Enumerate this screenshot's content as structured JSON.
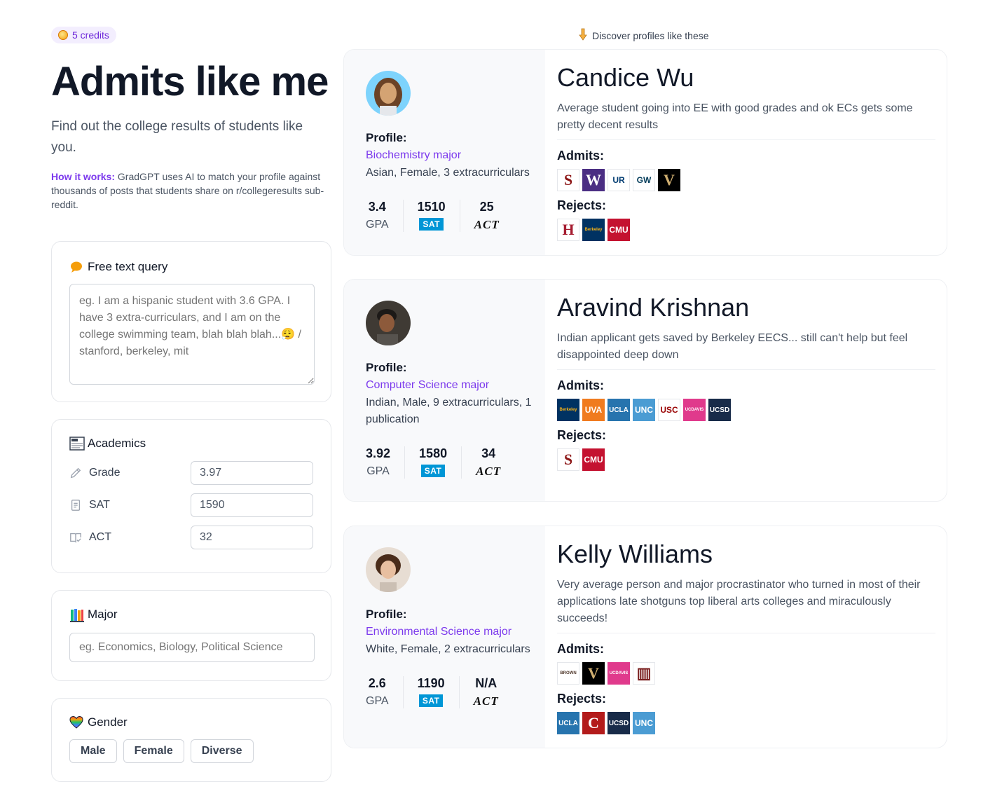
{
  "credits": "5 credits",
  "title": "Admits like me",
  "subtitle": "Find out the college results of students like you.",
  "how_it_works": {
    "label": "How it works:",
    "text": " GradGPT uses AI to match your profile against thousands of posts that students share on r/collegeresults sub-reddit."
  },
  "free_text": {
    "title": "Free text query",
    "placeholder": "eg. I am a hispanic student with 3.6 GPA. I have 3 extra-curriculars, and I am on the college swimming team, blah blah blah...😮‍💨 / stanford, berkeley, mit"
  },
  "academics": {
    "title": "Academics",
    "grade_label": "Grade",
    "grade_value": "3.97",
    "sat_label": "SAT",
    "sat_value": "1590",
    "act_label": "ACT",
    "act_value": "32"
  },
  "major": {
    "title": "Major",
    "placeholder": "eg. Economics, Biology, Political Science"
  },
  "gender": {
    "title": "Gender",
    "options": [
      "Male",
      "Female",
      "Diverse"
    ]
  },
  "discover": "Discover profiles like these",
  "profile_label": "Profile:",
  "gpa_label": "GPA",
  "sat_badge": "SAT",
  "act_badge": "ACT",
  "admits_label": "Admits:",
  "rejects_label": "Rejects:",
  "profiles": [
    {
      "name": "Candice Wu",
      "summary": "Average student going into EE with good grades and ok ECs gets some pretty decent results",
      "major": "Biochemistry major",
      "desc": "Asian, Female, 3 extracurriculars",
      "gpa": "3.4",
      "sat": "1510",
      "act": "25",
      "admits": [
        {
          "name": "stanford-logo",
          "bg": "#ffffff",
          "fg": "#8c1515",
          "text": "S"
        },
        {
          "name": "washington-logo",
          "bg": "#4b2e83",
          "fg": "#ffffff",
          "text": "W"
        },
        {
          "name": "rochester-logo",
          "bg": "#ffffff",
          "fg": "#003b71",
          "text": "UR"
        },
        {
          "name": "gw-logo",
          "bg": "#ffffff",
          "fg": "#033c5a",
          "text": "GW"
        },
        {
          "name": "vanderbilt-logo",
          "bg": "#000000",
          "fg": "#cfae70",
          "text": "V"
        }
      ],
      "rejects": [
        {
          "name": "harvard-logo",
          "bg": "#ffffff",
          "fg": "#a51c30",
          "text": "H"
        },
        {
          "name": "berkeley-logo",
          "bg": "#003262",
          "fg": "#fdb515",
          "text": "Berkeley"
        },
        {
          "name": "cmu-logo",
          "bg": "#c41230",
          "fg": "#ffffff",
          "text": "CMU"
        }
      ]
    },
    {
      "name": "Aravind Krishnan",
      "summary": "Indian applicant gets saved by Berkeley EECS... still can't help but feel disappointed deep down",
      "major": "Computer Science major",
      "desc": "Indian, Male, 9 extracurriculars, 1 publication",
      "gpa": "3.92",
      "sat": "1580",
      "act": "34",
      "admits": [
        {
          "name": "berkeley-logo",
          "bg": "#003262",
          "fg": "#fdb515",
          "text": "Berkeley"
        },
        {
          "name": "uva-logo",
          "bg": "#f07b1f",
          "fg": "#ffffff",
          "text": "UVA"
        },
        {
          "name": "ucla-logo",
          "bg": "#2774ae",
          "fg": "#ffffff",
          "text": "UCLA"
        },
        {
          "name": "unc-logo",
          "bg": "#4b9cd3",
          "fg": "#ffffff",
          "text": "UNC"
        },
        {
          "name": "usc-logo",
          "bg": "#ffffff",
          "fg": "#990000",
          "text": "USC"
        },
        {
          "name": "ucdavis-logo",
          "bg": "#e03a8c",
          "fg": "#ffffff",
          "text": "UCDAVIS"
        },
        {
          "name": "ucsd-logo",
          "bg": "#182b49",
          "fg": "#ffffff",
          "text": "UCSD"
        }
      ],
      "rejects": [
        {
          "name": "stanford-logo",
          "bg": "#ffffff",
          "fg": "#8c1515",
          "text": "S"
        },
        {
          "name": "cmu-logo",
          "bg": "#c41230",
          "fg": "#ffffff",
          "text": "CMU"
        }
      ]
    },
    {
      "name": "Kelly Williams",
      "summary": "Very average person and major procrastinator who turned in most of their applications late shotguns top liberal arts colleges and miraculously succeeds!",
      "major": "Environmental Science major",
      "desc": "White, Female, 2 extracurriculars",
      "gpa": "2.6",
      "sat": "1190",
      "act": "N/A",
      "admits": [
        {
          "name": "brown-logo",
          "bg": "#ffffff",
          "fg": "#4e3629",
          "text": "BROWN"
        },
        {
          "name": "vanderbilt-logo",
          "bg": "#000000",
          "fg": "#cfae70",
          "text": "V"
        },
        {
          "name": "ucdavis-logo",
          "bg": "#e03a8c",
          "fg": "#ffffff",
          "text": "UCDAVIS"
        },
        {
          "name": "college-building-logo",
          "bg": "#ffffff",
          "fg": "#7a1f1f",
          "text": "▥"
        }
      ],
      "rejects": [
        {
          "name": "ucla-logo",
          "bg": "#2774ae",
          "fg": "#ffffff",
          "text": "UCLA"
        },
        {
          "name": "cornell-logo",
          "bg": "#b31b1b",
          "fg": "#ffffff",
          "text": "C"
        },
        {
          "name": "ucsd-logo",
          "bg": "#182b49",
          "fg": "#ffffff",
          "text": "UCSD"
        },
        {
          "name": "unc-logo",
          "bg": "#4b9cd3",
          "fg": "#ffffff",
          "text": "UNC"
        }
      ]
    }
  ]
}
